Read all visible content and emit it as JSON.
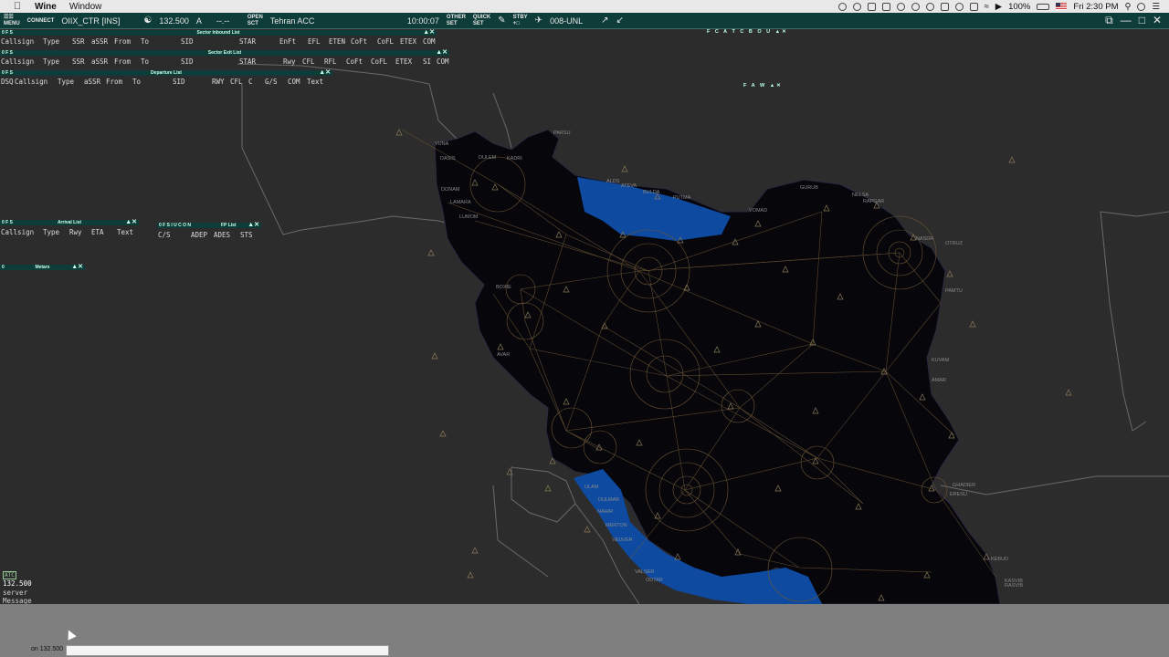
{
  "menubar": {
    "app": "Wine",
    "menu": "Window",
    "battery": "100%",
    "time": "Fri 2:30 PM"
  },
  "topbar": {
    "menu_label": "MENU",
    "connect_label": "CONNECT",
    "callsign": "OIIX_CTR [INS]",
    "frequency": "132.500",
    "atis_code": "A",
    "dashes": "--.--",
    "open_label": "OPEN",
    "sct_label": "SCT",
    "facility": "Tehran ACC",
    "clock": "10:00:07",
    "other_label": "OTHER",
    "set_label": "SET",
    "quick_label": "QUICK",
    "set2_label": "SET",
    "stby_label": "STBY",
    "alt_label": "008-UNL"
  },
  "lists": {
    "sector_inbound": {
      "tag": "0 F S",
      "title": "Sector Inbound List",
      "columns": [
        "Callsign",
        "Type",
        "SSR",
        "aSSR",
        "From",
        "To",
        "SID",
        "STAR",
        "EnFt",
        "EFL",
        "ETEN",
        "CoFt",
        "CoFL",
        "ETEX",
        "COM"
      ]
    },
    "sector_exit": {
      "tag": "0 F S",
      "title": "Sector Exit List",
      "columns": [
        "Callsign",
        "Type",
        "SSR",
        "aSSR",
        "From",
        "To",
        "SID",
        "STAR",
        "Rwy",
        "CFL",
        "RFL",
        "CoFt",
        "CoFL",
        "ETEX",
        "SI",
        "COM"
      ]
    },
    "departure": {
      "tag": "0 F S",
      "title": "Departure List",
      "columns": [
        "DSQ",
        "Callsign",
        "Type",
        "aSSR",
        "From",
        "To",
        "SID",
        "RWY",
        "CFL",
        "C",
        "G/S",
        "COM",
        "Text"
      ]
    },
    "arrival": {
      "tag": "0 F S",
      "title": "Arrival List",
      "columns": [
        "Callsign",
        "Type",
        "Rwy",
        "ETA",
        "Text"
      ]
    },
    "fp": {
      "tag": "0 F S I U C O N",
      "title": "FP List",
      "columns": [
        "C/S",
        "ADEP",
        "ADES",
        "STS"
      ]
    },
    "metar": {
      "tag": "0",
      "title": "Metars"
    },
    "facture_tag": "F C A T C B O U",
    "faw_tag": "F A W"
  },
  "fixes": {
    "vuna": "VUNA",
    "dasis": "DASIS",
    "dulem": "DULEM",
    "kadri": "KADRI",
    "parsu": "PARSU",
    "donam": "DONAM",
    "lamara": "LAMARA",
    "lumom": "LUMOM",
    "alds": "ALDS",
    "ateva": "ATEVA",
    "bulda": "BULDA",
    "putma": "PUTMA",
    "gurub": "GURUB",
    "nelsa": "NELSA",
    "rapgar": "RAPGAR",
    "vomad": "VOMAD",
    "nasdr": "NASDR",
    "otruz": "OTRUZ",
    "pamtu": "PAMTU",
    "boxie": "BOXIE",
    "avar": "AVAR",
    "kuvam": "KUVAM",
    "amar": "AMAR",
    "ulam": "ULAM",
    "ghadier": "GHADIER",
    "eresu": "ERESU",
    "dulmar": "DULMAR",
    "nahir": "NAHIR",
    "merton": "MERTON",
    "veuver": "VEUVER",
    "valser": "VALSER",
    "odtar": "ODTAR",
    "kebud": "KEBUD",
    "kasvib": "KASVIB",
    "rasvib": "RASVIB"
  },
  "chat": {
    "atc_tag": "ATC",
    "freq": "132.500",
    "line1": "server",
    "line2": "Message"
  },
  "cmdline": {
    "freq_label": "on 132.500",
    "input_value": ""
  },
  "colors": {
    "topbar": "#0e3c38",
    "land": "#06060b",
    "sea": "#0d4aa0",
    "background": "#2c2c2c",
    "route": "#8a6a3c"
  }
}
